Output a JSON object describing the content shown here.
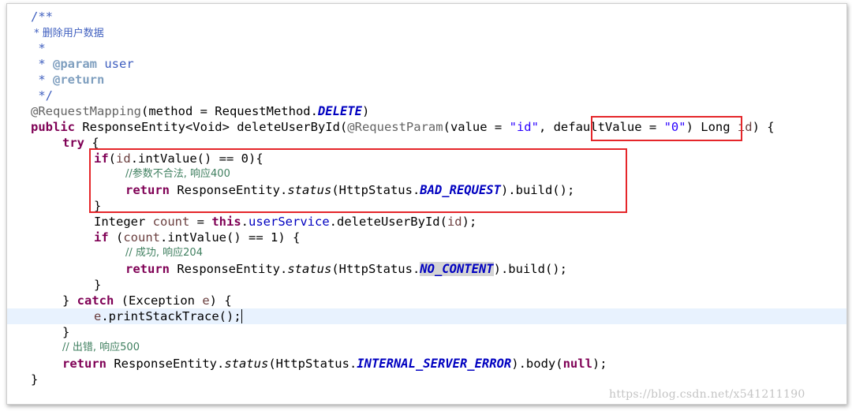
{
  "code_lines": {
    "l01": "/**",
    "l02": " * 删除用户数据",
    "l03": " *",
    "l04_prefix": " * ",
    "l04_tag": "@param",
    "l04_rest": " user",
    "l05_prefix": " * ",
    "l05_tag": "@return",
    "l06": " */",
    "l07_ann": "@RequestMapping",
    "l07_a": "(method = RequestMethod.",
    "l07_const": "DELETE",
    "l07_b": ")",
    "l08_kw": "public",
    "l08_a": " ResponseEntity<Void> deleteUserById(",
    "l08_ann": "@RequestParam",
    "l08_b": "(value = ",
    "l08_str1": "\"id\"",
    "l08_c": ", defaultValue = ",
    "l08_str2": "\"0\"",
    "l08_d": ") Long ",
    "l08_var": "id",
    "l08_e": ") {",
    "l09_kw": "try",
    "l09_rest": " {",
    "l10_kw": "if",
    "l10_a": "(",
    "l10_var": "id",
    "l10_b": ".intValue() == 0){",
    "l11": "//参数不合法, 响应400",
    "l12_kw": "return",
    "l12_a": " ResponseEntity.",
    "l12_method": "status",
    "l12_b": "(HttpStatus.",
    "l12_const": "BAD_REQUEST",
    "l12_c": ").build();",
    "l13": "}",
    "l14_a": "Integer ",
    "l14_var": "count",
    "l14_b": " = ",
    "l14_kw": "this",
    "l14_c": ".",
    "l14_fld": "userService",
    "l14_d": ".deleteUserById(",
    "l14_var2": "id",
    "l14_e": ");",
    "l15_kw": "if",
    "l15_a": " (",
    "l15_var": "count",
    "l15_b": ".intValue() == 1) {",
    "l16": "// 成功, 响应204",
    "l17_kw": "return",
    "l17_a": " ResponseEntity.",
    "l17_method": "status",
    "l17_b": "(HttpStatus.",
    "l17_const": "NO_CONTENT",
    "l17_c": ").build();",
    "l18": "}",
    "l19_a": "} ",
    "l19_kw": "catch",
    "l19_b": " (Exception ",
    "l19_var": "e",
    "l19_c": ") {",
    "l20_var": "e",
    "l20_a": ".printStackTrace();",
    "l21": "}",
    "l22": "// 出错, 响应500",
    "l23_kw": "return",
    "l23_a": " ResponseEntity.",
    "l23_method": "status",
    "l23_b": "(HttpStatus.",
    "l23_const": "INTERNAL_SERVER_ERROR",
    "l23_c": ").body(",
    "l23_null": "null",
    "l23_d": ");",
    "l24": "}"
  },
  "watermark": "https://blog.csdn.net/x541211190",
  "colors": {
    "highlight_box": "#e5262a",
    "current_line": "#e8f2fe",
    "keyword": "#7f0055",
    "string": "#2a00ff",
    "comment": "#3f7f5f",
    "javadoc": "#3f5fbf"
  }
}
